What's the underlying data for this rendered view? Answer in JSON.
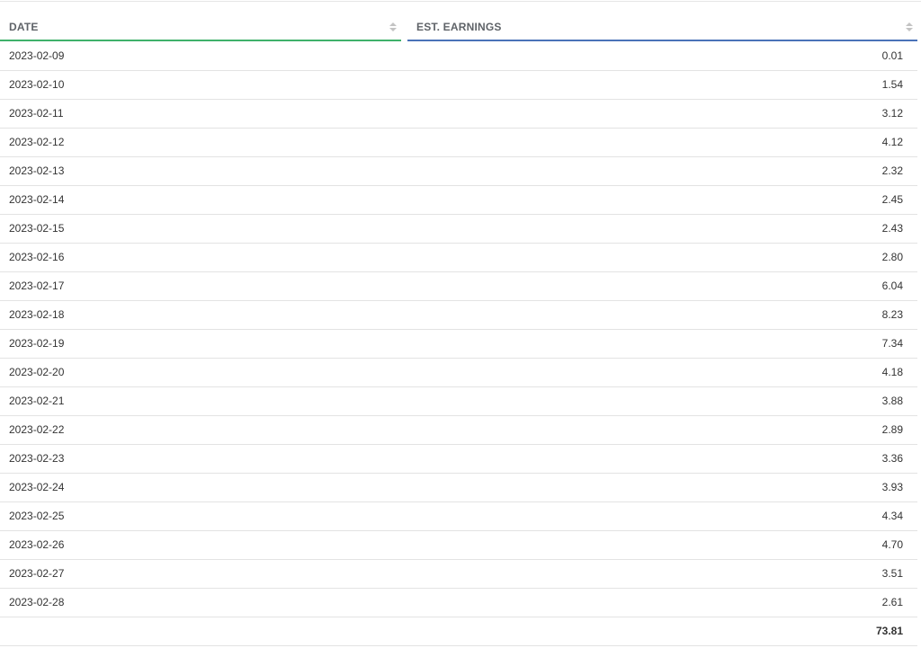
{
  "table": {
    "columns": [
      {
        "label": "DATE",
        "accent": "#3fb16a"
      },
      {
        "label": "EST. EARNINGS",
        "accent": "#4a72b8"
      }
    ],
    "rows": [
      {
        "date": "2023-02-09",
        "earnings": "0.01"
      },
      {
        "date": "2023-02-10",
        "earnings": "1.54"
      },
      {
        "date": "2023-02-11",
        "earnings": "3.12"
      },
      {
        "date": "2023-02-12",
        "earnings": "4.12"
      },
      {
        "date": "2023-02-13",
        "earnings": "2.32"
      },
      {
        "date": "2023-02-14",
        "earnings": "2.45"
      },
      {
        "date": "2023-02-15",
        "earnings": "2.43"
      },
      {
        "date": "2023-02-16",
        "earnings": "2.80"
      },
      {
        "date": "2023-02-17",
        "earnings": "6.04"
      },
      {
        "date": "2023-02-18",
        "earnings": "8.23"
      },
      {
        "date": "2023-02-19",
        "earnings": "7.34"
      },
      {
        "date": "2023-02-20",
        "earnings": "4.18"
      },
      {
        "date": "2023-02-21",
        "earnings": "3.88"
      },
      {
        "date": "2023-02-22",
        "earnings": "2.89"
      },
      {
        "date": "2023-02-23",
        "earnings": "3.36"
      },
      {
        "date": "2023-02-24",
        "earnings": "3.93"
      },
      {
        "date": "2023-02-25",
        "earnings": "4.34"
      },
      {
        "date": "2023-02-26",
        "earnings": "4.70"
      },
      {
        "date": "2023-02-27",
        "earnings": "3.51"
      },
      {
        "date": "2023-02-28",
        "earnings": "2.61"
      }
    ],
    "total": "73.81",
    "sort_icon": "sort-arrows-icon"
  }
}
